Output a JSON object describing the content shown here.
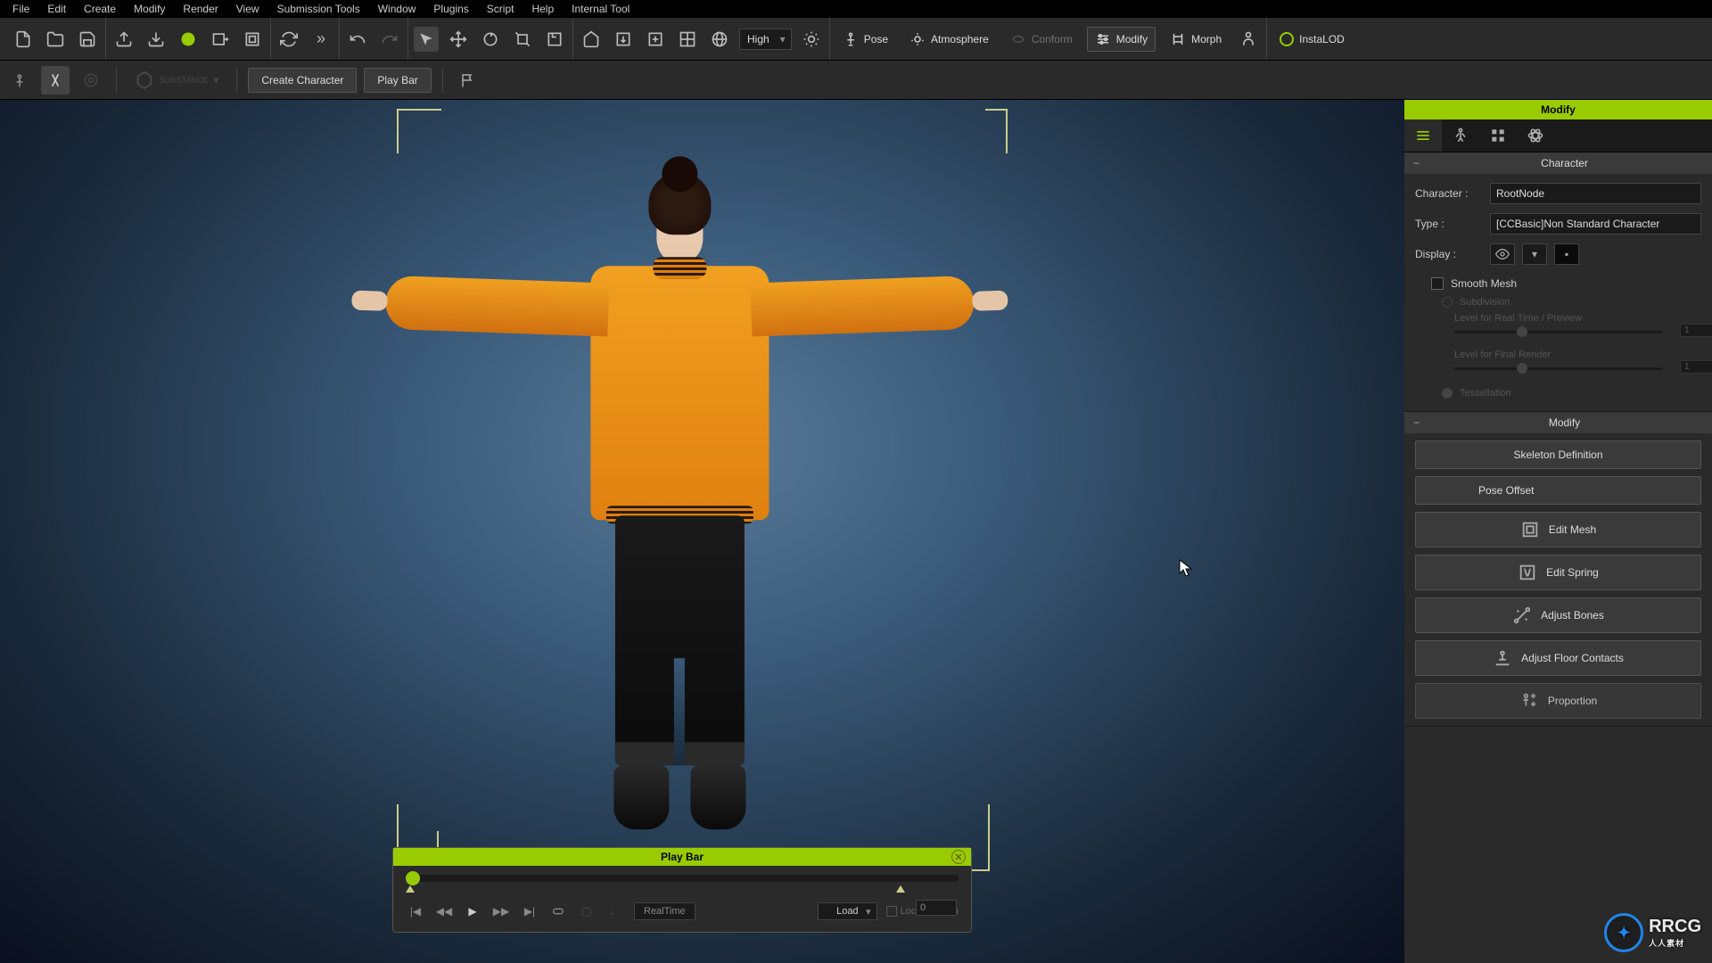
{
  "menu": [
    "File",
    "Edit",
    "Create",
    "Modify",
    "Render",
    "View",
    "Submission Tools",
    "Window",
    "Plugins",
    "Script",
    "Help",
    "Internal Tool"
  ],
  "toolbar": {
    "quality": "High",
    "pose": "Pose",
    "atmosphere": "Atmosphere",
    "conform": "Conform",
    "modify": "Modify",
    "morph": "Morph",
    "instalod": "InstaLOD"
  },
  "subtoolbar": {
    "substance": "SUBSTANCE",
    "create_character": "Create Character",
    "play_bar": "Play Bar"
  },
  "playbar": {
    "title": "Play Bar",
    "frame": "0",
    "realtime": "RealTime",
    "load": "Load",
    "lock_position": "Lock Position"
  },
  "panel": {
    "title": "Modify",
    "character_section": "Character",
    "character_label": "Character :",
    "character_value": "RootNode",
    "type_label": "Type :",
    "type_value": "[CCBasic]Non Standard Character",
    "display_label": "Display :",
    "smooth_mesh": "Smooth Mesh",
    "subdivision": "Subdivision",
    "realtime_preview": "Level for Real Time / Preview",
    "realtime_val": "1",
    "final_render": "Level for Final Render",
    "final_val": "1",
    "tessellation": "Tessellation",
    "modify_section": "Modify",
    "skeleton_definition": "Skeleton Definition",
    "pose_offset": "Pose Offset",
    "edit_mesh": "Edit Mesh",
    "edit_spring": "Edit Spring",
    "adjust_bones": "Adjust Bones",
    "adjust_floor": "Adjust Floor Contacts",
    "proportion": "Proportion"
  },
  "watermark": {
    "text": "RRCG",
    "sub": "人人素材"
  }
}
